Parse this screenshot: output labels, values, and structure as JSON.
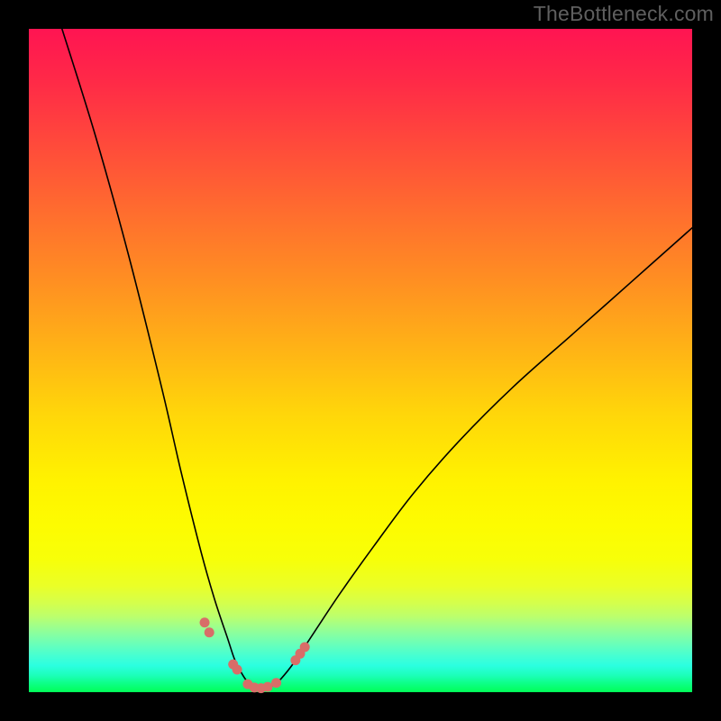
{
  "watermark": "TheBottleneck.com",
  "chart_data": {
    "type": "line",
    "title": "",
    "xlabel": "",
    "ylabel": "",
    "x_range": [
      0,
      100
    ],
    "y_range": [
      0,
      100
    ],
    "grid": false,
    "legend": false,
    "description": "Asymmetric V-shaped bottleneck curve over vertical rainbow gradient (red at top → green at bottom). Minimum near x≈34 at y≈0. Left branch rises steeply to top-left; right branch rises more gradually toward upper-right (~y≈70 at x=100). No axis ticks or numeric labels are visible.",
    "series": [
      {
        "name": "bottleneck-curve",
        "x": [
          5,
          10,
          15,
          20,
          23,
          26,
          28,
          30,
          31,
          32,
          33,
          34,
          35,
          36,
          37,
          38,
          40,
          43,
          47,
          52,
          58,
          65,
          73,
          82,
          91,
          100
        ],
        "y": [
          100,
          84,
          66,
          46,
          33,
          21,
          14,
          8,
          5,
          3,
          1.5,
          0.7,
          0.4,
          0.6,
          1.2,
          2,
          4.5,
          9,
          15,
          22,
          30,
          38,
          46,
          54,
          62,
          70
        ]
      }
    ],
    "markers": {
      "name": "highlight-dots",
      "color": "#d86d68",
      "radius_px": 5.5,
      "x": [
        26.5,
        27.2,
        30.8,
        31.4,
        33.0,
        34.0,
        35.0,
        36.0,
        37.3,
        40.2,
        40.9,
        41.6
      ],
      "y": [
        10.5,
        9.0,
        4.2,
        3.4,
        1.2,
        0.7,
        0.6,
        0.8,
        1.4,
        4.8,
        5.8,
        6.8
      ]
    },
    "gradient_stops": [
      {
        "pos": 0.0,
        "color": "#ff1452"
      },
      {
        "pos": 0.18,
        "color": "#ff4c3a"
      },
      {
        "pos": 0.38,
        "color": "#ff8f22"
      },
      {
        "pos": 0.58,
        "color": "#ffd60a"
      },
      {
        "pos": 0.75,
        "color": "#fdfc01"
      },
      {
        "pos": 0.9,
        "color": "#a0ff8a"
      },
      {
        "pos": 1.0,
        "color": "#02ff58"
      }
    ]
  }
}
